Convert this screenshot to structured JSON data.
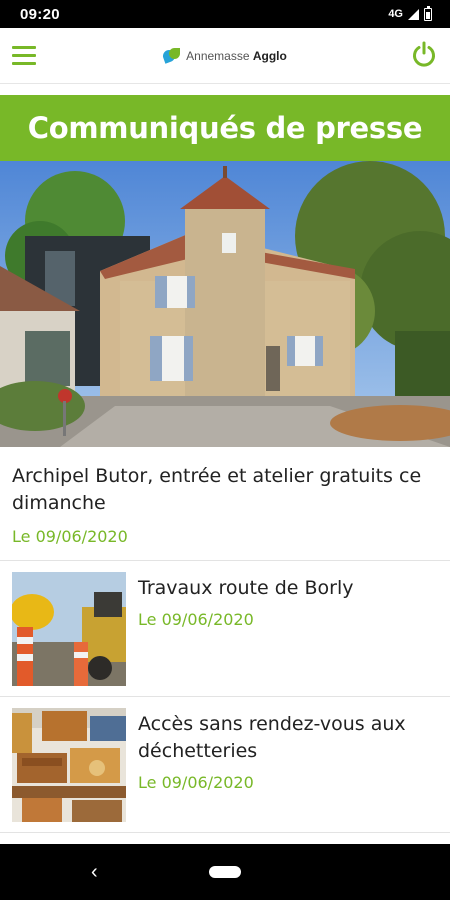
{
  "status_bar": {
    "time": "09:20",
    "network": "4G"
  },
  "header": {
    "menu_icon": "hamburger-icon",
    "logo": {
      "light": "Annemasse",
      "bold": "Agglo"
    },
    "power_icon": "power-icon",
    "accent_color": "#78b828"
  },
  "page": {
    "title": "Communiqués de presse"
  },
  "featured": {
    "title": "Archipel Butor, entrée et atelier gratuits ce dimanche",
    "date": "Le 09/06/2020"
  },
  "articles": [
    {
      "title": "Travaux route de Borly",
      "date": "Le 09/06/2020"
    },
    {
      "title": "Accès sans rendez-vous aux déchetteries",
      "date": "Le 09/06/2020"
    }
  ],
  "nav_bar": {
    "back_icon": "back-chevron-icon",
    "home_icon": "home-pill-icon"
  }
}
